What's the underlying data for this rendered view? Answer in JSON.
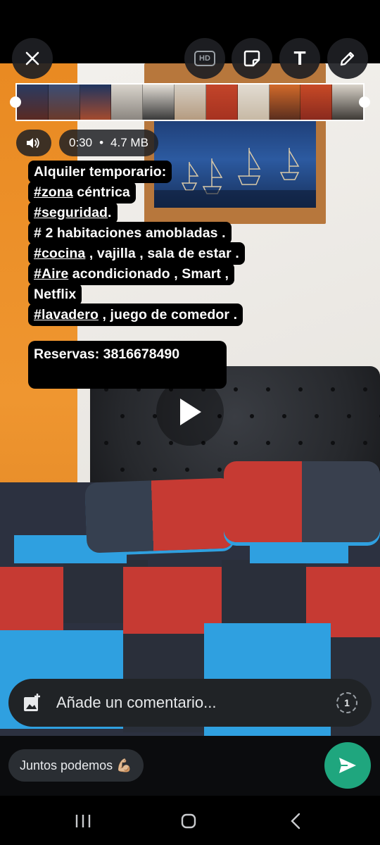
{
  "toolbar": {
    "close_icon": "close-icon",
    "hd_label": "HD",
    "sticker_icon": "sticker-icon",
    "text_tool_label": "T",
    "pencil_icon": "pencil-icon"
  },
  "video_info": {
    "duration": "0:30",
    "separator": "•",
    "size": "4.7 MB"
  },
  "caption": {
    "lines": [
      [
        {
          "t": "Alquiler temporario:",
          "tag": false
        }
      ],
      [
        {
          "t": "#zona",
          "tag": true
        },
        {
          "t": " céntrica",
          "tag": false
        }
      ],
      [
        {
          "t": "#seguridad",
          "tag": true
        },
        {
          "t": ".",
          "tag": false
        }
      ],
      [
        {
          "t": "# 2 habitaciones amobladas .",
          "tag": false
        }
      ],
      [
        {
          "t": "#cocina",
          "tag": true
        },
        {
          "t": " , vajilla , sala de estar .",
          "tag": false
        }
      ],
      [
        {
          "t": "#Aire",
          "tag": true
        },
        {
          "t": " acondicionado , Smart ,",
          "tag": false
        }
      ],
      [
        {
          "t": "Netflix",
          "tag": false
        }
      ],
      [
        {
          "t": "#lavadero",
          "tag": true
        },
        {
          "t": " , juego de comedor .",
          "tag": false
        }
      ]
    ],
    "reservations": "Reservas: 3816678490"
  },
  "comment": {
    "placeholder": "Añade un comentario...",
    "add_media_icon": "add-image-icon",
    "view_once_label": "1"
  },
  "recipient": {
    "label": "Juntos podemos 💪🏼"
  },
  "colors": {
    "send_button": "#1fa67e",
    "pill_bg": "#202326"
  }
}
